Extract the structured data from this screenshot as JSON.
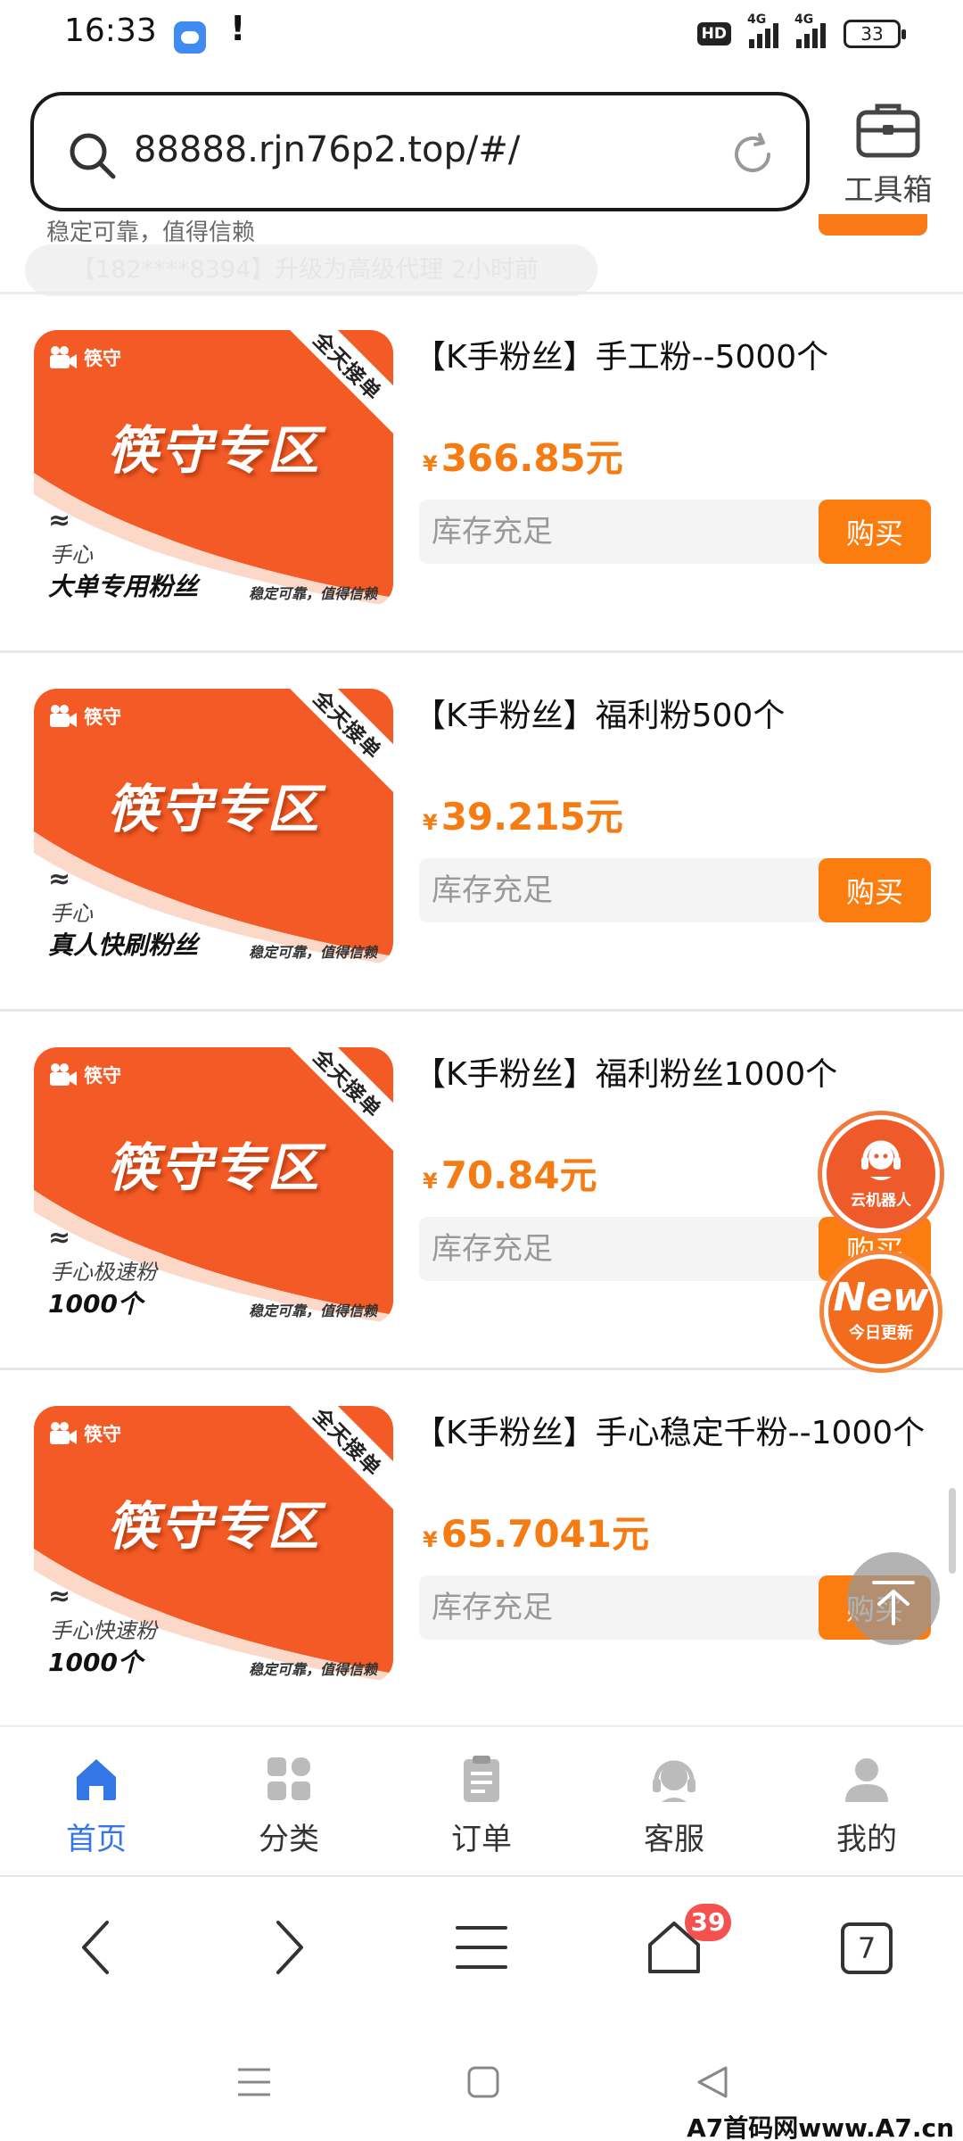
{
  "status_bar": {
    "time": "16:33",
    "alert": "!",
    "hd": "HD",
    "network_1": "4G",
    "network_2": "4G",
    "battery": "33"
  },
  "address_bar": {
    "url": "88888.rjn76p2.top/#/",
    "toolbox_label": "工具箱"
  },
  "partial": {
    "previous_item_text": "稳定可靠，值得信赖",
    "ticker": "【182****8394】升级为高级代理 2小时前"
  },
  "thumbnail_common": {
    "brand": "筷守",
    "banner": "全天接单",
    "title": "筷守专区",
    "wave": "≈",
    "slogan": "稳定可靠，值得信赖"
  },
  "products": [
    {
      "title": "【K手粉丝】手工粉--5000个",
      "currency": "¥",
      "price": "366.85元",
      "stock": "库存充足",
      "buy": "购买",
      "thumb_small": "手心",
      "thumb_big": "大单专用粉丝"
    },
    {
      "title": "【K手粉丝】福利粉500个",
      "currency": "¥",
      "price": "39.215元",
      "stock": "库存充足",
      "buy": "购买",
      "thumb_small": "手心",
      "thumb_big": "真人快刷粉丝"
    },
    {
      "title": "【K手粉丝】福利粉丝1000个",
      "currency": "¥",
      "price": "70.84元",
      "stock": "库存充足",
      "buy": "购买",
      "thumb_small": "手心极速粉",
      "thumb_big": "1000个"
    },
    {
      "title": "【K手粉丝】手心稳定千粉--1000个",
      "currency": "¥",
      "price": "65.7041元",
      "stock": "库存充足",
      "buy": "购买",
      "thumb_small": "手心快速粉",
      "thumb_big": "1000个"
    }
  ],
  "floating": {
    "robot_label": "云机器人",
    "new_label": "New",
    "new_sub": "今日更新"
  },
  "tab_bar": {
    "tabs": [
      {
        "label": "首页",
        "icon": "home-icon",
        "active": true
      },
      {
        "label": "分类",
        "icon": "category-icon",
        "active": false
      },
      {
        "label": "订单",
        "icon": "order-icon",
        "active": false
      },
      {
        "label": "客服",
        "icon": "support-icon",
        "active": false
      },
      {
        "label": "我的",
        "icon": "profile-icon",
        "active": false
      }
    ]
  },
  "browser_nav": {
    "home_badge": "39",
    "tab_count": "7"
  },
  "watermark": "A7首码网www.A7.cn",
  "colors": {
    "accent_orange": "#fb7d10",
    "price_orange": "#f47c12",
    "active_blue": "#3377e6",
    "badge_red": "#f55151"
  }
}
